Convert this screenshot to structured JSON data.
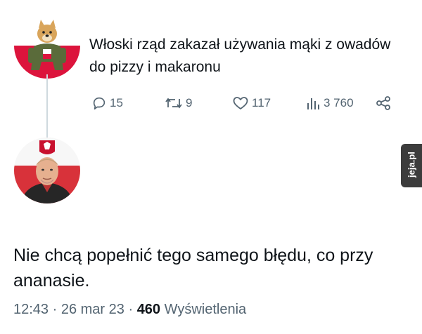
{
  "tweet1": {
    "text": "Włoski rząd zakazał używania mąki z owadów do pizzy i makaronu",
    "avatar_icon": "doge-soldier-poland-flag-avatar",
    "actions": {
      "replies": "15",
      "retweets": "9",
      "likes": "117",
      "views": "3 760"
    }
  },
  "tweet2": {
    "text": "Nie chcą popełnić tego samego błędu, co przy ananasie.",
    "avatar_icon": "man-profile-photo-avatar",
    "meta": {
      "time": "12:43",
      "separator": " · ",
      "date": "26 mar 23",
      "views_count": "460",
      "views_label": "Wyświetlenia"
    }
  },
  "watermark": {
    "text": "jeja.pl"
  },
  "colors": {
    "text": "#0f1419",
    "muted": "#536471",
    "thread_line": "#cfd9de",
    "poland_red": "#dc143c"
  }
}
